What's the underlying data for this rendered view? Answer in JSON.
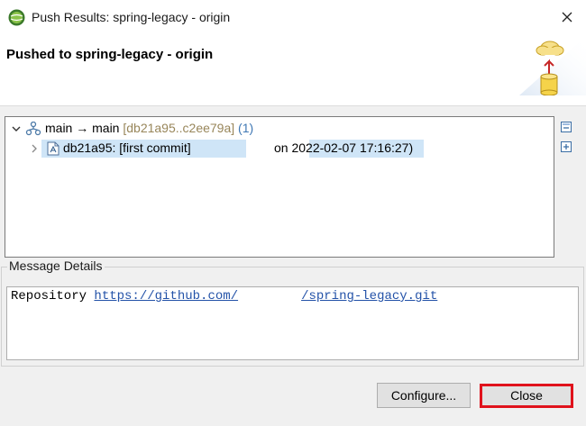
{
  "window": {
    "title": "Push Results: spring-legacy - origin",
    "app_icon": "eclipse-icon",
    "close_icon": "close-icon"
  },
  "banner": {
    "title": "Pushed to spring-legacy - origin",
    "art_icon": "cloud-push-database-icon"
  },
  "tree": {
    "ref_row": {
      "label": "main → main",
      "range": "[db21a95..c2ee79a]",
      "count": "(1)",
      "icon": "branch-icon"
    },
    "commit_row": {
      "label": "db21a95: [first commit]",
      "date": "on 2022-02-07 17:16:27)",
      "icon": "commit-file-icon"
    },
    "collapse_all_icon": "collapse-all-icon",
    "expand_all_icon": "expand-all-icon"
  },
  "message_details": {
    "label": "Message Details",
    "prefix": "Repository ",
    "link_start": "https://github.com/",
    "link_end": "/spring-legacy.git"
  },
  "buttons": {
    "configure": "Configure...",
    "close": "Close"
  },
  "colors": {
    "selection": "#cfe5f7",
    "link": "#2352a8",
    "highlight_border": "#e0121c",
    "range_text": "#98865a",
    "count_text": "#3f78b4"
  }
}
